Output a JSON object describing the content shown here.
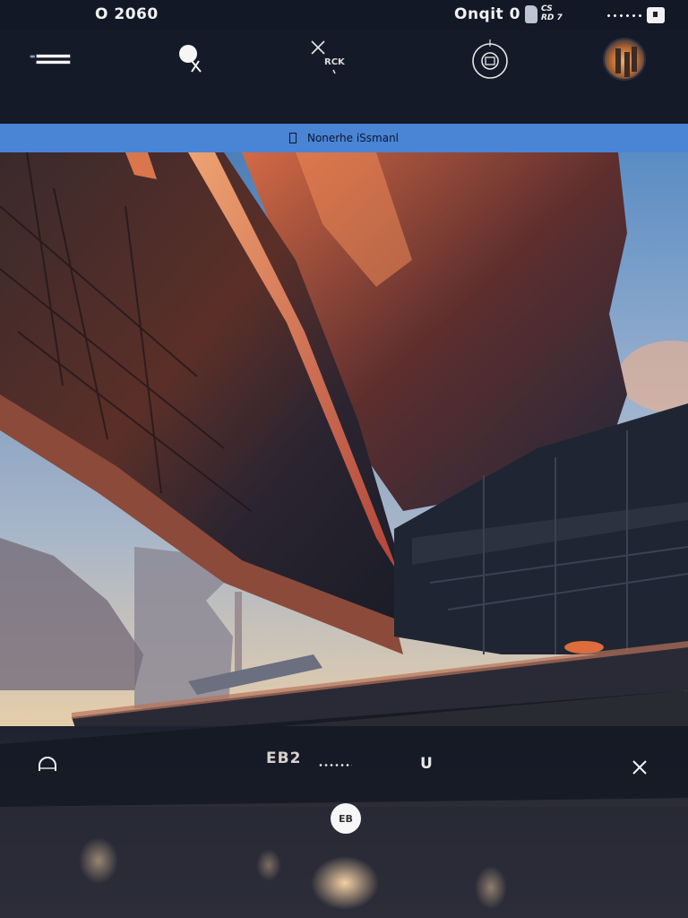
{
  "status_bar": {
    "time": "O 2060",
    "carrier": "Onqit 0",
    "network_line1": "CS",
    "network_line2": "RD 7"
  },
  "toolbar": {
    "menu_icon": "menu-icon",
    "search_icon": "search-icon",
    "close_icon": "close-icon",
    "close_label": "RCK",
    "camera_icon": "camera-icon",
    "avatar_icon": "avatar"
  },
  "banner": {
    "text": "Nonerhe iSsmanl"
  },
  "bottom_controls": {
    "left_icon": "headphones-icon",
    "code_text": "EB2",
    "u_label": "U",
    "x_icon": "close-icon",
    "center_button_label": "EB"
  },
  "colors": {
    "banner": "#4a84d4",
    "toolbar": "#141a28",
    "status_bar": "#121826"
  }
}
